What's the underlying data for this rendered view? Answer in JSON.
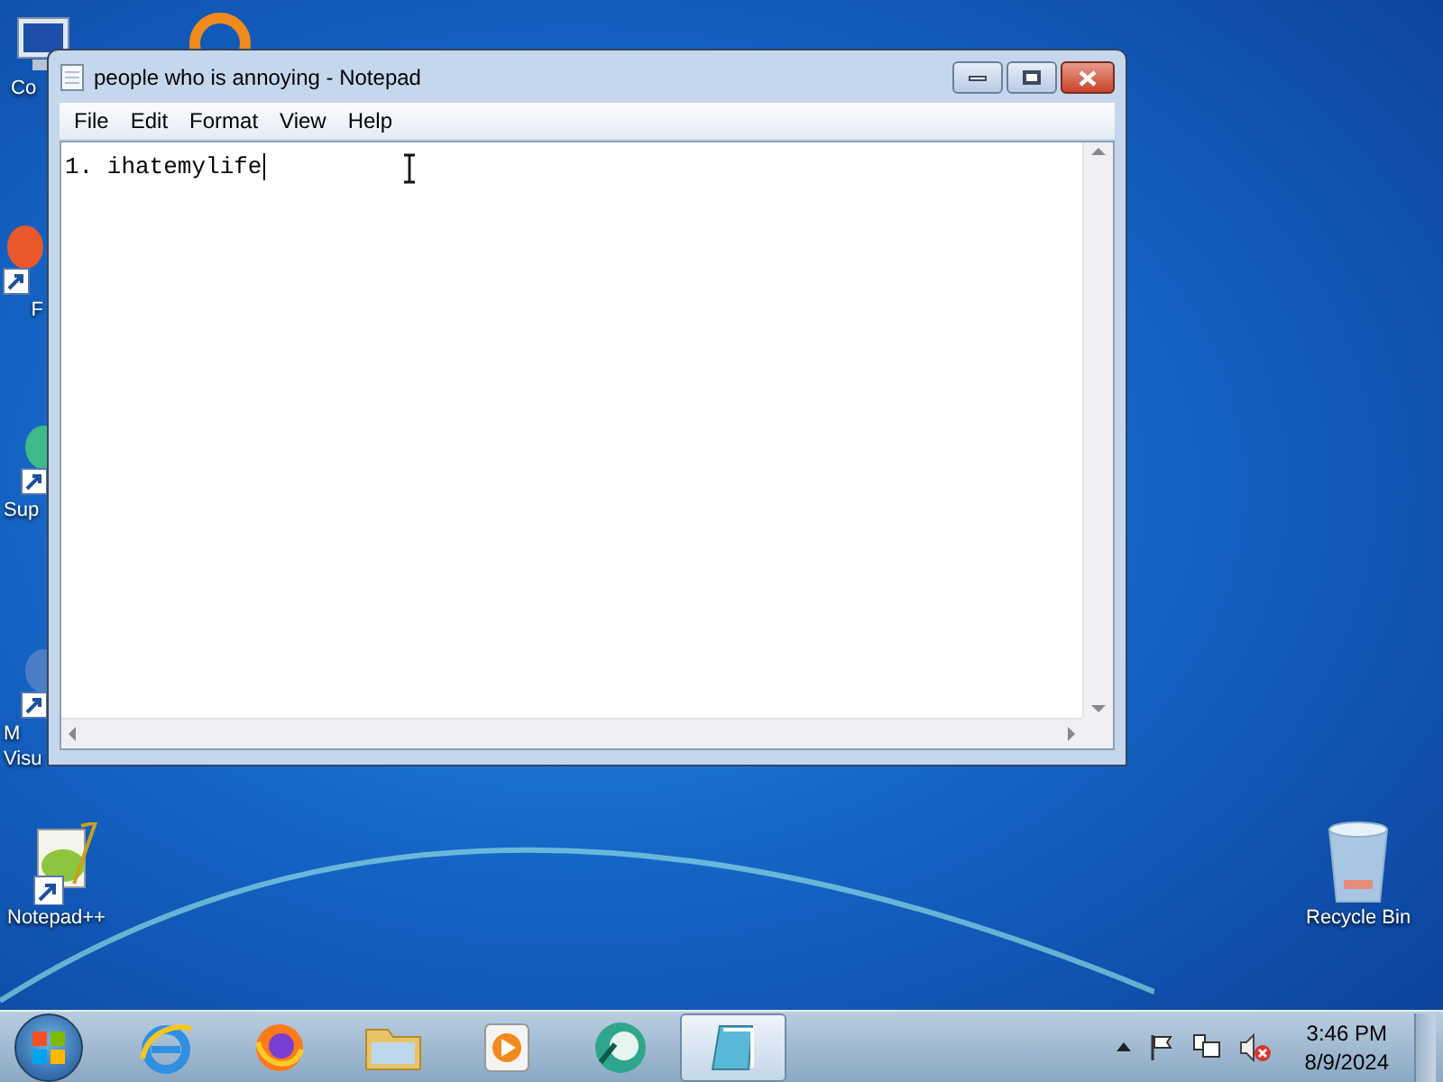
{
  "desktop_icons": [
    {
      "kind": "computer",
      "label": "Co"
    },
    {
      "kind": "orange"
    },
    {
      "kind": "shortcut-red",
      "label": "F"
    },
    {
      "kind": "shortcut-green",
      "label": "Sup"
    },
    {
      "kind": "shortcut-blue",
      "label": "M\nVisu"
    },
    {
      "kind": "notepadpp",
      "label": "Notepad++"
    },
    {
      "kind": "recycle",
      "label": "Recycle Bin"
    }
  ],
  "window": {
    "title": "people who is annoying - Notepad",
    "menu": [
      "File",
      "Edit",
      "Format",
      "View",
      "Help"
    ],
    "text": "1. ihatemylife"
  },
  "taskbar": {
    "items": [
      {
        "kind": "ie",
        "selected": false
      },
      {
        "kind": "firefox",
        "selected": false
      },
      {
        "kind": "explorer",
        "selected": false
      },
      {
        "kind": "media",
        "selected": false
      },
      {
        "kind": "green",
        "selected": false
      },
      {
        "kind": "notepad",
        "selected": true
      }
    ],
    "time": "3:46 PM",
    "date": "8/9/2024"
  }
}
